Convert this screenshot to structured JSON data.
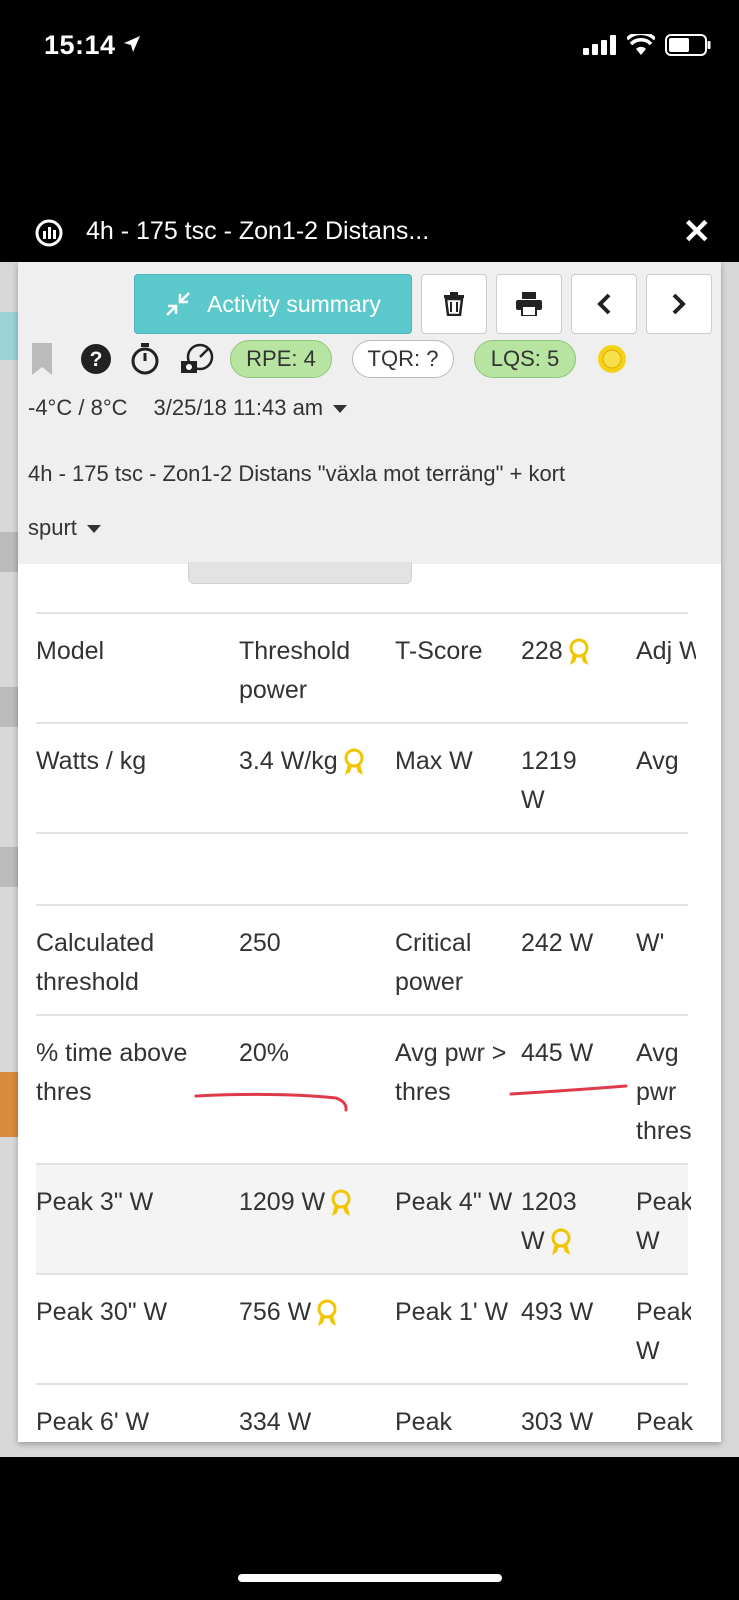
{
  "status_bar": {
    "time": "15:14"
  },
  "modal": {
    "title": "4h - 175 tsc - Zon1-2 Distans..."
  },
  "toolbar": {
    "summary_label": "Activity summary"
  },
  "badges": {
    "rpe": "RPE: 4",
    "tqr": "TQR: ?",
    "lqs": "LQS: 5"
  },
  "meta": {
    "temperature": "-4°C / 8°C",
    "datetime": "3/25/18 11:43 am"
  },
  "description": {
    "line1": "4h - 175 tsc - Zon1-2 Distans \"växla mot terräng\" + kort",
    "line2": "spurt"
  },
  "stats": {
    "rows": [
      {
        "c1": "Model",
        "c2": "Threshold power",
        "c3": "T-Score",
        "c4": "228",
        "c5": "Adj W"
      },
      {
        "c1": "Watts / kg",
        "c2": "3.4 W/kg",
        "c3": "Max W",
        "c4": "1219 W",
        "c5": "Avg"
      },
      {
        "c1": "",
        "c2": "",
        "c3": "",
        "c4": "",
        "c5": ""
      },
      {
        "c1": "Calculated threshold",
        "c2": "250",
        "c3": "Critical power",
        "c4": "242 W",
        "c5": "W'"
      },
      {
        "c1": "% time above thres",
        "c2": "20%",
        "c3": "Avg pwr > thres",
        "c4": "445 W",
        "c5": "Avg pwr thres"
      },
      {
        "c1": "Peak 3\" W",
        "c2": "1209 W",
        "c3": "Peak 4\" W",
        "c4": "1203 W",
        "c5": "Peak W"
      },
      {
        "c1": "Peak 30\" W",
        "c2": "756 W",
        "c3": "Peak 1' W",
        "c4": "493 W",
        "c5": "Peak W"
      },
      {
        "c1": "Peak 6' W",
        "c2": "334 W",
        "c3": "Peak",
        "c4": "303 W",
        "c5": "Peak"
      }
    ]
  }
}
